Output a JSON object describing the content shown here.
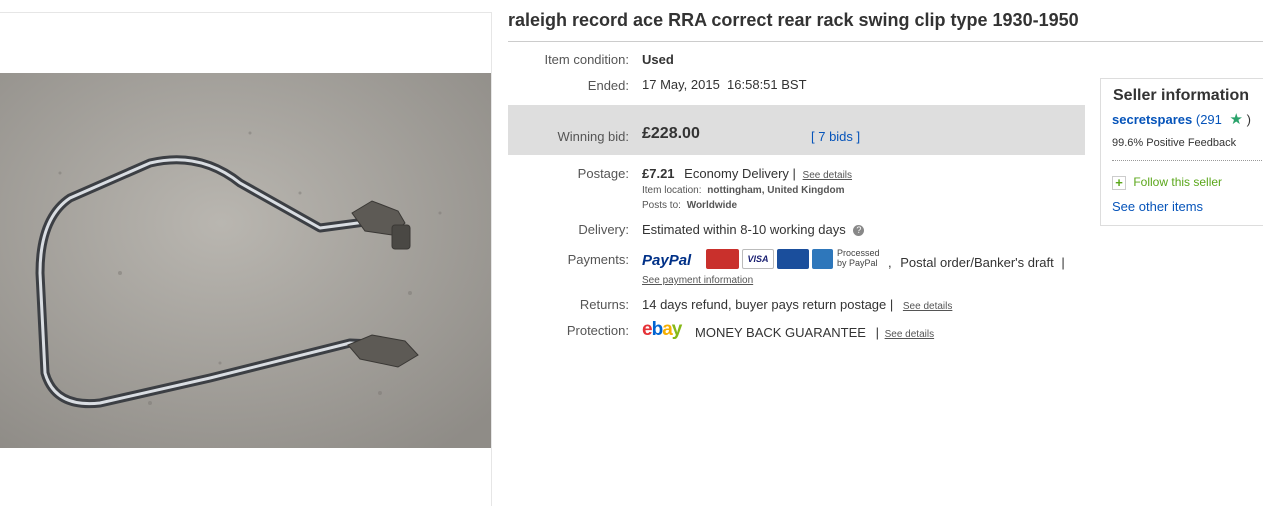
{
  "listing": {
    "title": "raleigh record ace RRA correct rear rack swing clip type 1930-1950"
  },
  "details": {
    "condition_label": "Item condition:",
    "condition_value": "Used",
    "ended_label": "Ended:",
    "ended_value": "17 May, 2015  16:58:51 BST",
    "winning_bid_label": "Winning bid:",
    "winning_bid_value": "£228.00",
    "bids_link": "[ 7 bids ]",
    "postage_label": "Postage:",
    "postage_price": "£7.21",
    "postage_method": "Economy Delivery |",
    "postage_see_details": "See details",
    "item_location_label": "Item location:",
    "item_location_value": "nottingham, United Kingdom",
    "posts_to_label": "Posts to:",
    "posts_to_value": "Worldwide",
    "delivery_label": "Delivery:",
    "delivery_value": "Estimated within 8-10 working days",
    "payments_label": "Payments:",
    "paypal_logo": "PayPal",
    "processed_line1": "Processed",
    "processed_line2": "by PayPal",
    "payments_other": "Postal order/Banker's draft",
    "payments_separator": "|",
    "payments_comma": ",",
    "see_payment_info": "See payment information",
    "returns_label": "Returns:",
    "returns_value": "14 days refund, buyer pays return postage |",
    "returns_see_details": "See details",
    "protection_label": "Protection:",
    "ebay_logo": "ebay",
    "protection_value": "MONEY BACK GUARANTEE",
    "protection_separator": "|",
    "protection_see_details": "See details"
  },
  "cards": [
    {
      "name": "MasterCard",
      "label": "MasterCard",
      "color": "#c9302c"
    },
    {
      "name": "VISA",
      "label": "VISA",
      "color": "#ffffff"
    },
    {
      "name": "Maestro",
      "label": "Maestro",
      "color": "#1a4e9c"
    },
    {
      "name": "American Express",
      "label": "AMEX",
      "color": "#2e77bb"
    }
  ],
  "seller": {
    "heading": "Seller information",
    "username": "secretspares",
    "feedback_open": "(291",
    "feedback_close": ")",
    "positive": "99.6% Positive Feedback",
    "follow": "Follow this seller",
    "other_items": "See other items"
  },
  "colors": {
    "link_blue": "#0654ba",
    "bid_box": "#dedede",
    "follow_green": "#5ba71b"
  }
}
